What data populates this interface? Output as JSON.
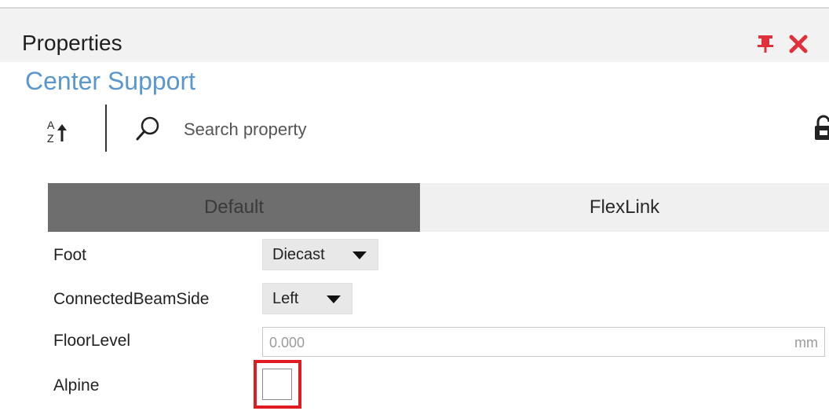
{
  "panel": {
    "title": "Properties",
    "object_name": "Center Support",
    "accent_color": "#5a97cf",
    "close_color": "#e0303a"
  },
  "toolbar": {
    "sort_icon": "sort-az-icon",
    "search_icon": "search-icon",
    "lock_icon": "lock-icon",
    "search": {
      "placeholder": "Search property",
      "value": ""
    }
  },
  "tabs": [
    {
      "label": "Default",
      "selected": true
    },
    {
      "label": "FlexLink",
      "selected": false
    }
  ],
  "properties": {
    "foot": {
      "label": "Foot",
      "value": "Diecast"
    },
    "connected_beam_side": {
      "label": "ConnectedBeamSide",
      "value": "Left"
    },
    "floor_level": {
      "label": "FloorLevel",
      "value": "0.000",
      "unit": "mm"
    },
    "alpine": {
      "label": "Alpine",
      "checked": false
    }
  },
  "highlight_color": "#e01b22"
}
